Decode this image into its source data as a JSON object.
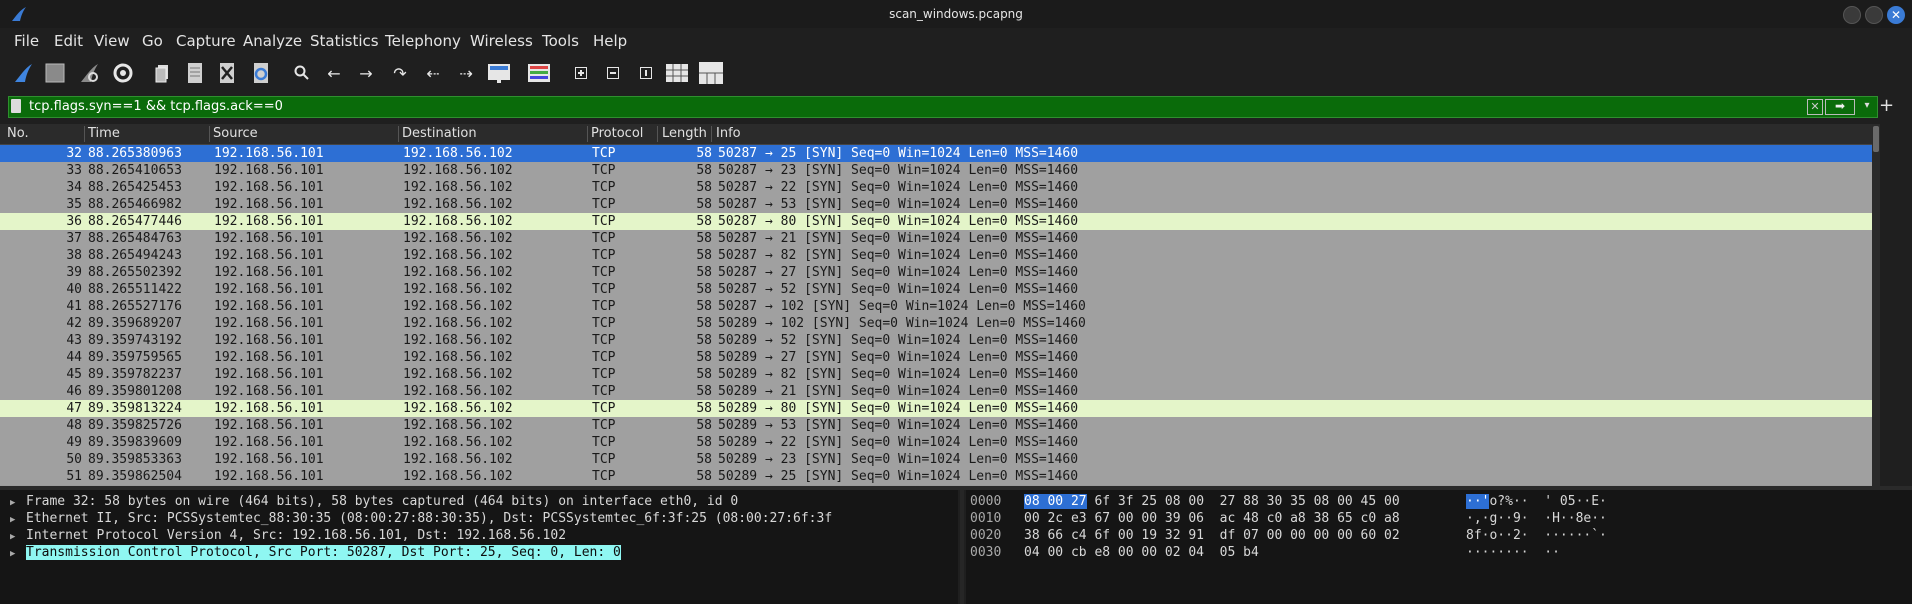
{
  "window": {
    "title": "scan_windows.pcapng"
  },
  "menu": [
    "File",
    "Edit",
    "View",
    "Go",
    "Capture",
    "Analyze",
    "Statistics",
    "Telephony",
    "Wireless",
    "Tools",
    "Help"
  ],
  "filter": {
    "value": "tcp.flags.syn==1 && tcp.flags.ack==0"
  },
  "columns": {
    "no": "No.",
    "time": "Time",
    "source": "Source",
    "destination": "Destination",
    "protocol": "Protocol",
    "length": "Length",
    "info": "Info"
  },
  "packets": [
    {
      "no": "32",
      "time": "88.265380963",
      "src": "192.168.56.101",
      "dst": "192.168.56.102",
      "proto": "TCP",
      "len": "58",
      "info": "50287 → 25 [SYN] Seq=0 Win=1024 Len=0 MSS=1460",
      "state": "sel"
    },
    {
      "no": "33",
      "time": "88.265410653",
      "src": "192.168.56.101",
      "dst": "192.168.56.102",
      "proto": "TCP",
      "len": "58",
      "info": "50287 → 23 [SYN] Seq=0 Win=1024 Len=0 MSS=1460",
      "state": ""
    },
    {
      "no": "34",
      "time": "88.265425453",
      "src": "192.168.56.101",
      "dst": "192.168.56.102",
      "proto": "TCP",
      "len": "58",
      "info": "50287 → 22 [SYN] Seq=0 Win=1024 Len=0 MSS=1460",
      "state": ""
    },
    {
      "no": "35",
      "time": "88.265466982",
      "src": "192.168.56.101",
      "dst": "192.168.56.102",
      "proto": "TCP",
      "len": "58",
      "info": "50287 → 53 [SYN] Seq=0 Win=1024 Len=0 MSS=1460",
      "state": ""
    },
    {
      "no": "36",
      "time": "88.265477446",
      "src": "192.168.56.101",
      "dst": "192.168.56.102",
      "proto": "TCP",
      "len": "58",
      "info": "50287 → 80 [SYN] Seq=0 Win=1024 Len=0 MSS=1460",
      "state": "hl"
    },
    {
      "no": "37",
      "time": "88.265484763",
      "src": "192.168.56.101",
      "dst": "192.168.56.102",
      "proto": "TCP",
      "len": "58",
      "info": "50287 → 21 [SYN] Seq=0 Win=1024 Len=0 MSS=1460",
      "state": ""
    },
    {
      "no": "38",
      "time": "88.265494243",
      "src": "192.168.56.101",
      "dst": "192.168.56.102",
      "proto": "TCP",
      "len": "58",
      "info": "50287 → 82 [SYN] Seq=0 Win=1024 Len=0 MSS=1460",
      "state": ""
    },
    {
      "no": "39",
      "time": "88.265502392",
      "src": "192.168.56.101",
      "dst": "192.168.56.102",
      "proto": "TCP",
      "len": "58",
      "info": "50287 → 27 [SYN] Seq=0 Win=1024 Len=0 MSS=1460",
      "state": ""
    },
    {
      "no": "40",
      "time": "88.265511422",
      "src": "192.168.56.101",
      "dst": "192.168.56.102",
      "proto": "TCP",
      "len": "58",
      "info": "50287 → 52 [SYN] Seq=0 Win=1024 Len=0 MSS=1460",
      "state": ""
    },
    {
      "no": "41",
      "time": "88.265527176",
      "src": "192.168.56.101",
      "dst": "192.168.56.102",
      "proto": "TCP",
      "len": "58",
      "info": "50287 → 102 [SYN] Seq=0 Win=1024 Len=0 MSS=1460",
      "state": ""
    },
    {
      "no": "42",
      "time": "89.359689207",
      "src": "192.168.56.101",
      "dst": "192.168.56.102",
      "proto": "TCP",
      "len": "58",
      "info": "50289 → 102 [SYN] Seq=0 Win=1024 Len=0 MSS=1460",
      "state": ""
    },
    {
      "no": "43",
      "time": "89.359743192",
      "src": "192.168.56.101",
      "dst": "192.168.56.102",
      "proto": "TCP",
      "len": "58",
      "info": "50289 → 52 [SYN] Seq=0 Win=1024 Len=0 MSS=1460",
      "state": ""
    },
    {
      "no": "44",
      "time": "89.359759565",
      "src": "192.168.56.101",
      "dst": "192.168.56.102",
      "proto": "TCP",
      "len": "58",
      "info": "50289 → 27 [SYN] Seq=0 Win=1024 Len=0 MSS=1460",
      "state": ""
    },
    {
      "no": "45",
      "time": "89.359782237",
      "src": "192.168.56.101",
      "dst": "192.168.56.102",
      "proto": "TCP",
      "len": "58",
      "info": "50289 → 82 [SYN] Seq=0 Win=1024 Len=0 MSS=1460",
      "state": ""
    },
    {
      "no": "46",
      "time": "89.359801208",
      "src": "192.168.56.101",
      "dst": "192.168.56.102",
      "proto": "TCP",
      "len": "58",
      "info": "50289 → 21 [SYN] Seq=0 Win=1024 Len=0 MSS=1460",
      "state": ""
    },
    {
      "no": "47",
      "time": "89.359813224",
      "src": "192.168.56.101",
      "dst": "192.168.56.102",
      "proto": "TCP",
      "len": "58",
      "info": "50289 → 80 [SYN] Seq=0 Win=1024 Len=0 MSS=1460",
      "state": "hl"
    },
    {
      "no": "48",
      "time": "89.359825726",
      "src": "192.168.56.101",
      "dst": "192.168.56.102",
      "proto": "TCP",
      "len": "58",
      "info": "50289 → 53 [SYN] Seq=0 Win=1024 Len=0 MSS=1460",
      "state": ""
    },
    {
      "no": "49",
      "time": "89.359839609",
      "src": "192.168.56.101",
      "dst": "192.168.56.102",
      "proto": "TCP",
      "len": "58",
      "info": "50289 → 22 [SYN] Seq=0 Win=1024 Len=0 MSS=1460",
      "state": ""
    },
    {
      "no": "50",
      "time": "89.359853363",
      "src": "192.168.56.101",
      "dst": "192.168.56.102",
      "proto": "TCP",
      "len": "58",
      "info": "50289 → 23 [SYN] Seq=0 Win=1024 Len=0 MSS=1460",
      "state": ""
    },
    {
      "no": "51",
      "time": "89.359862504",
      "src": "192.168.56.101",
      "dst": "192.168.56.102",
      "proto": "TCP",
      "len": "58",
      "info": "50289 → 25 [SYN] Seq=0 Win=1024 Len=0 MSS=1460",
      "state": ""
    }
  ],
  "details": [
    {
      "text": "Frame 32: 58 bytes on wire (464 bits), 58 bytes captured (464 bits) on interface eth0, id 0",
      "selected": false
    },
    {
      "text": "Ethernet II, Src: PCSSystemtec_88:30:35 (08:00:27:88:30:35), Dst: PCSSystemtec_6f:3f:25 (08:00:27:6f:3f",
      "selected": false
    },
    {
      "text": "Internet Protocol Version 4, Src: 192.168.56.101, Dst: 192.168.56.102",
      "selected": false
    },
    {
      "text": "Transmission Control Protocol, Src Port: 50287, Dst Port: 25, Seq: 0, Len: 0",
      "selected": true
    }
  ],
  "bytes": [
    {
      "offset": "0000",
      "hex_sel": "08 00 27",
      "hex": " 6f 3f 25 08 00  27 88 30 35 08 00 45 00",
      "ascii_sel": "··'",
      "ascii": "o?%··  ' 05··E·"
    },
    {
      "offset": "0010",
      "hex_sel": "",
      "hex": "00 2c e3 67 00 00 39 06  ac 48 c0 a8 38 65 c0 a8",
      "ascii_sel": "",
      "ascii": "·,·g··9·  ·H··8e··"
    },
    {
      "offset": "0020",
      "hex_sel": "",
      "hex": "38 66 c4 6f 00 19 32 91  df 07 00 00 00 00 60 02",
      "ascii_sel": "",
      "ascii": "8f·o··2·  ······`·"
    },
    {
      "offset": "0030",
      "hex_sel": "",
      "hex": "04 00 cb e8 00 00 02 04  05 b4",
      "ascii_sel": "",
      "ascii": "········  ··"
    }
  ]
}
